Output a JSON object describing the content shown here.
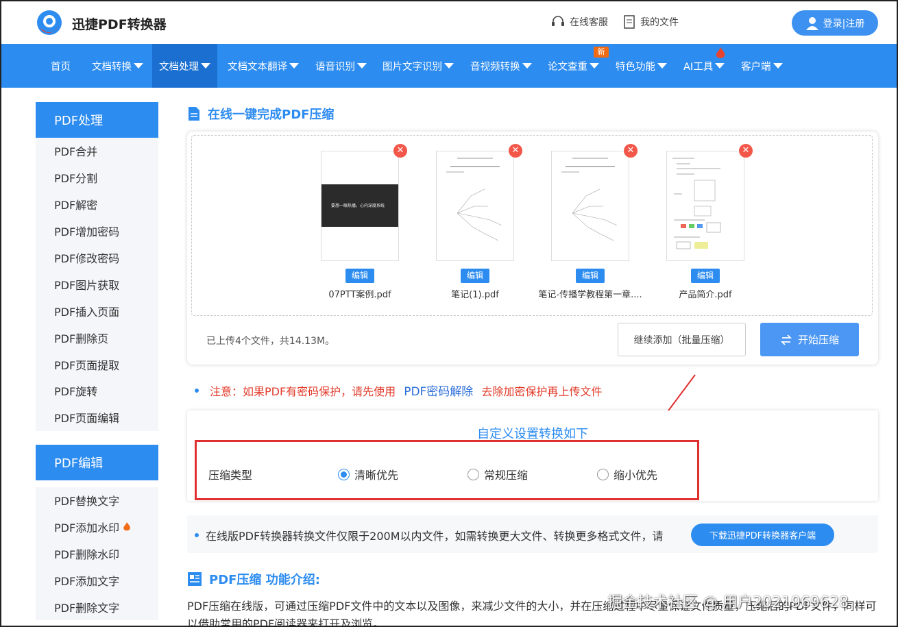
{
  "header": {
    "brand": "迅捷PDF转换器",
    "service": "在线客服",
    "my_files": "我的文件",
    "login": "登录|注册"
  },
  "nav": {
    "items": [
      {
        "label": "首页"
      },
      {
        "label": "文档转换"
      },
      {
        "label": "文档处理"
      },
      {
        "label": "文档文本翻译"
      },
      {
        "label": "语音识别"
      },
      {
        "label": "图片文字识别"
      },
      {
        "label": "音视频转换"
      },
      {
        "label": "论文查重"
      },
      {
        "label": "特色功能"
      },
      {
        "label": "AI工具"
      },
      {
        "label": "客户端"
      }
    ],
    "new_badge": "新"
  },
  "sidebar": {
    "group1_title": "PDF处理",
    "group1_items": [
      "PDF合并",
      "PDF分割",
      "PDF解密",
      "PDF增加密码",
      "PDF修改密码",
      "PDF图片获取",
      "PDF插入页面",
      "PDF删除页",
      "PDF页面提取",
      "PDF旋转",
      "PDF页面编辑"
    ],
    "group2_title": "PDF编辑",
    "group2_items": [
      "PDF替换文字",
      "PDF添加水印",
      "PDF删除水印",
      "PDF添加文字",
      "PDF删除文字"
    ]
  },
  "main": {
    "title": "在线一键完成PDF压缩",
    "files": [
      {
        "name": "07PTT案例.pdf",
        "edit": "编辑"
      },
      {
        "name": "笔记(1).pdf",
        "edit": "编辑"
      },
      {
        "name": "笔记-传播学教程第一章....",
        "edit": "编辑"
      },
      {
        "name": "产品简介.pdf",
        "edit": "编辑"
      }
    ],
    "thumb1_text": "要想一眼热播，心内深度系统",
    "upload_info": "已上传4个文件，共14.13M。",
    "continue_btn": "继续添加（批量压缩）",
    "start_btn": "开始压缩",
    "note_prefix": "注意：如果PDF有密码保护，请先使用",
    "note_link": "PDF密码解除",
    "note_suffix": "去除加密保护再上传文件",
    "settings_title": "自定义设置转换如下",
    "compress_label": "压缩类型",
    "options": [
      "清晰优先",
      "常规压缩",
      "缩小优先"
    ],
    "selected_option": "清晰优先",
    "limit_text": "在线版PDF转换器转换文件仅限于200M以内文件，如需转换更大文件、转换更多格式文件，请",
    "download_btn": "下载迅捷PDF转换器客户端",
    "intro_title": "PDF压缩 功能介绍:",
    "intro_text": "PDF压缩在线版，可通过压缩PDF文件中的文本以及图像，来减少文件的大小，并在压缩过程中尽量保证文件质量，压缩后的PDF文件，同样可以借助常用的PDF阅读器来打开及浏览。"
  },
  "watermark": "掘金技术社区 @ 用户2021969628"
}
